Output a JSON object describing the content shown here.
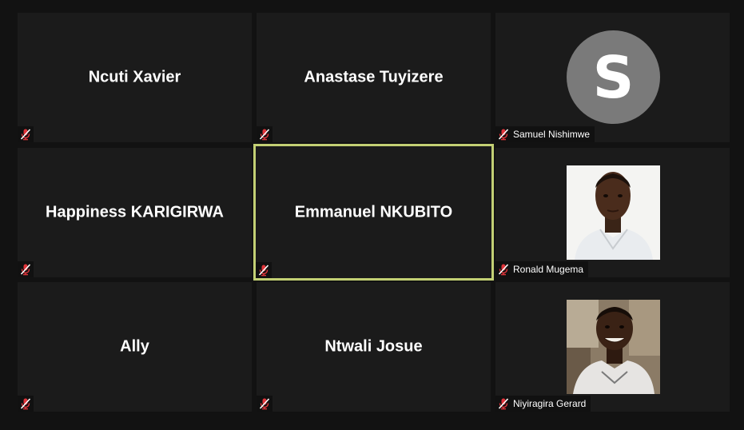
{
  "participants": [
    {
      "name": "Ncuti Xavier",
      "muted": true
    },
    {
      "name": "Anastase Tuyizere",
      "muted": true
    },
    {
      "name": "Samuel Nishimwe",
      "muted": true,
      "avatar_letter": "S",
      "avatar_color": "#7a7a7a"
    },
    {
      "name": "Happiness KARIGIRWA",
      "muted": true
    },
    {
      "name": "Emmanuel NKUBITO",
      "muted": true,
      "active_speaker": true
    },
    {
      "name": "Ronald Mugema",
      "muted": true,
      "video": "photo"
    },
    {
      "name": "Ally",
      "muted": true
    },
    {
      "name": "Ntwali Josue",
      "muted": true
    },
    {
      "name": "Niyiragira Gerard",
      "muted": true,
      "video": "photo"
    }
  ],
  "colors": {
    "background": "#121212",
    "tile": "#1b1b1b",
    "active_border": "#c3d074",
    "mute_icon": "#e0343a"
  },
  "icons": {
    "mute": "mic-muted-icon"
  }
}
